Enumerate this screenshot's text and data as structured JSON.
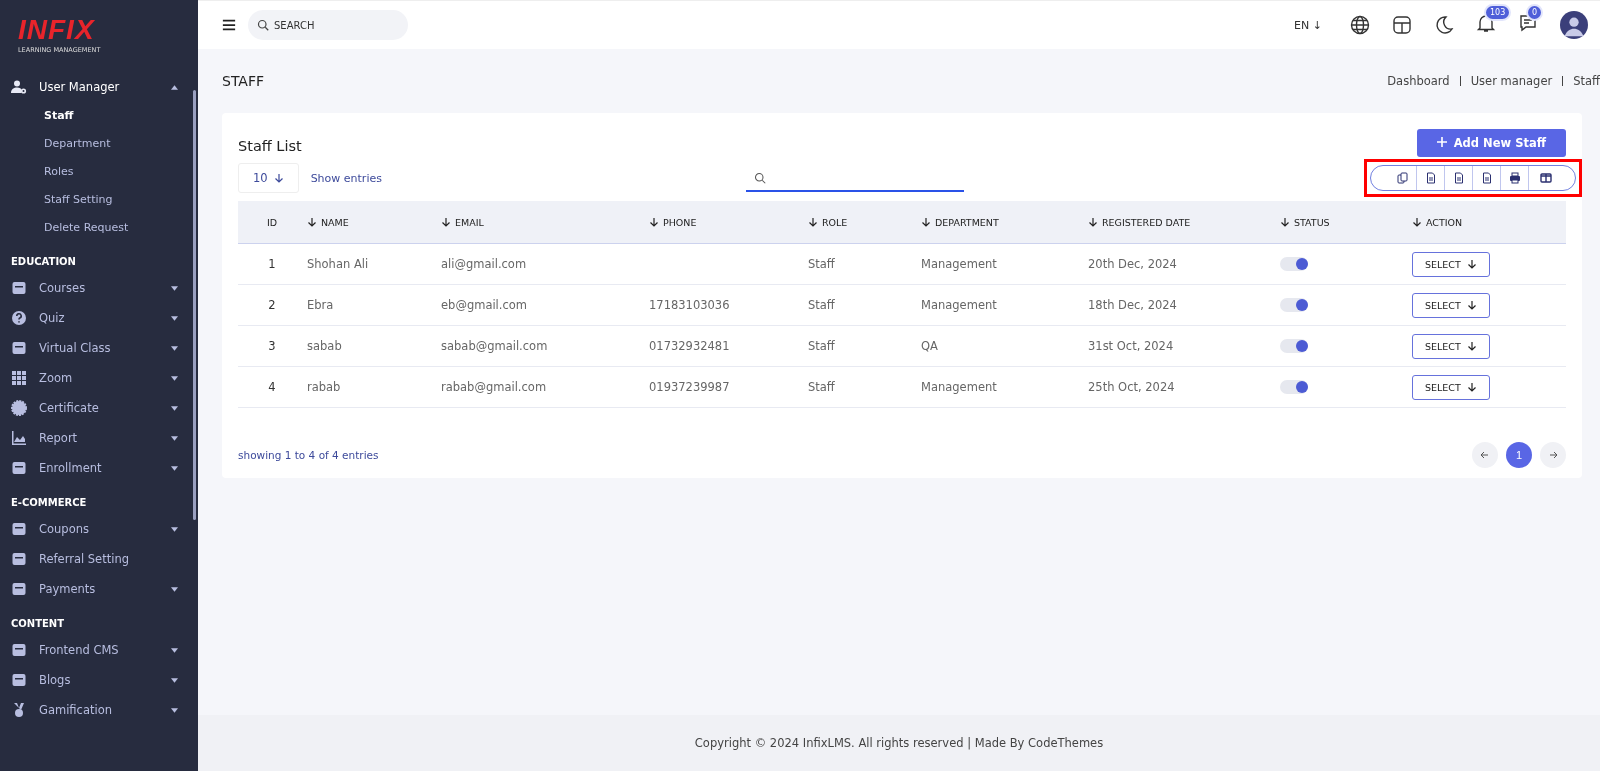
{
  "sidebar": {
    "logo": {
      "brand": "INFIX",
      "tagline": "LEARNING MANAGEMENT"
    },
    "sections": [
      {
        "items": [
          {
            "label": "User Manager",
            "expanded": true,
            "has_caret": true,
            "children": [
              {
                "label": "Staff",
                "selected": true
              },
              {
                "label": "Department",
                "selected": false
              },
              {
                "label": "Roles",
                "selected": false
              },
              {
                "label": "Staff Setting",
                "selected": false
              },
              {
                "label": "Delete Request",
                "selected": false
              }
            ]
          }
        ]
      },
      {
        "heading": "EDUCATION",
        "items": [
          {
            "label": "Courses",
            "expanded": false,
            "has_caret": true
          },
          {
            "label": "Quiz",
            "expanded": false,
            "has_caret": true
          },
          {
            "label": "Virtual Class",
            "expanded": false,
            "has_caret": true
          },
          {
            "label": "Zoom",
            "expanded": false,
            "has_caret": true
          },
          {
            "label": "Certificate",
            "expanded": false,
            "has_caret": true
          },
          {
            "label": "Report",
            "expanded": false,
            "has_caret": true
          },
          {
            "label": "Enrollment",
            "expanded": false,
            "has_caret": true
          }
        ]
      },
      {
        "heading": "E-COMMERCE",
        "items": [
          {
            "label": "Coupons",
            "expanded": false,
            "has_caret": true
          },
          {
            "label": "Referral Setting",
            "expanded": false,
            "has_caret": false
          },
          {
            "label": "Payments",
            "expanded": false,
            "has_caret": true
          }
        ]
      },
      {
        "heading": "CONTENT",
        "items": [
          {
            "label": "Frontend CMS",
            "expanded": false,
            "has_caret": true
          },
          {
            "label": "Blogs",
            "expanded": false,
            "has_caret": true
          },
          {
            "label": "Gamification",
            "expanded": false,
            "has_caret": true
          }
        ]
      }
    ]
  },
  "topbar": {
    "search": {
      "placeholder": "SEARCH"
    },
    "language": "EN ↓",
    "notifications": "103",
    "messages": "0"
  },
  "page": {
    "title": "STAFF",
    "breadcrumb": [
      "Dashboard",
      "User manager",
      "Staff"
    ]
  },
  "card": {
    "title": "Staff List",
    "add_button": "Add New Staff",
    "page_length": "10",
    "show_entries": "Show entries",
    "columns": [
      {
        "label": "ID",
        "sortable": false
      },
      {
        "label": "NAME",
        "sortable": true
      },
      {
        "label": "EMAIL",
        "sortable": true
      },
      {
        "label": "PHONE",
        "sortable": true
      },
      {
        "label": "ROLE",
        "sortable": true
      },
      {
        "label": "DEPARTMENT",
        "sortable": true
      },
      {
        "label": "REGISTERED DATE",
        "sortable": true
      },
      {
        "label": "STATUS",
        "sortable": true
      },
      {
        "label": "ACTION",
        "sortable": true
      }
    ],
    "rows": [
      {
        "id": "1",
        "name": "Shohan Ali",
        "email": "ali@gmail.com",
        "phone": "",
        "role": "Staff",
        "department": "Management",
        "registered": "20th Dec, 2024",
        "status": true,
        "action": "SELECT"
      },
      {
        "id": "2",
        "name": "Ebra",
        "email": "eb@gmail.com",
        "phone": "17183103036",
        "role": "Staff",
        "department": "Management",
        "registered": "18th Dec, 2024",
        "status": true,
        "action": "SELECT"
      },
      {
        "id": "3",
        "name": "sabab",
        "email": "sabab@gmail.com",
        "phone": "01732932481",
        "role": "Staff",
        "department": "QA",
        "registered": "31st Oct, 2024",
        "status": true,
        "action": "SELECT"
      },
      {
        "id": "4",
        "name": "rabab",
        "email": "rabab@gmail.com",
        "phone": "01937239987",
        "role": "Staff",
        "department": "Management",
        "registered": "25th Oct, 2024",
        "status": true,
        "action": "SELECT"
      }
    ],
    "summary": "showing 1 to 4 of 4 entries",
    "pages": [
      {
        "label": "1",
        "selected": true
      }
    ],
    "export_highlighted": true
  },
  "footer": "Copyright © 2024 InfixLMS. All rights reserved | Made By CodeThemes"
}
